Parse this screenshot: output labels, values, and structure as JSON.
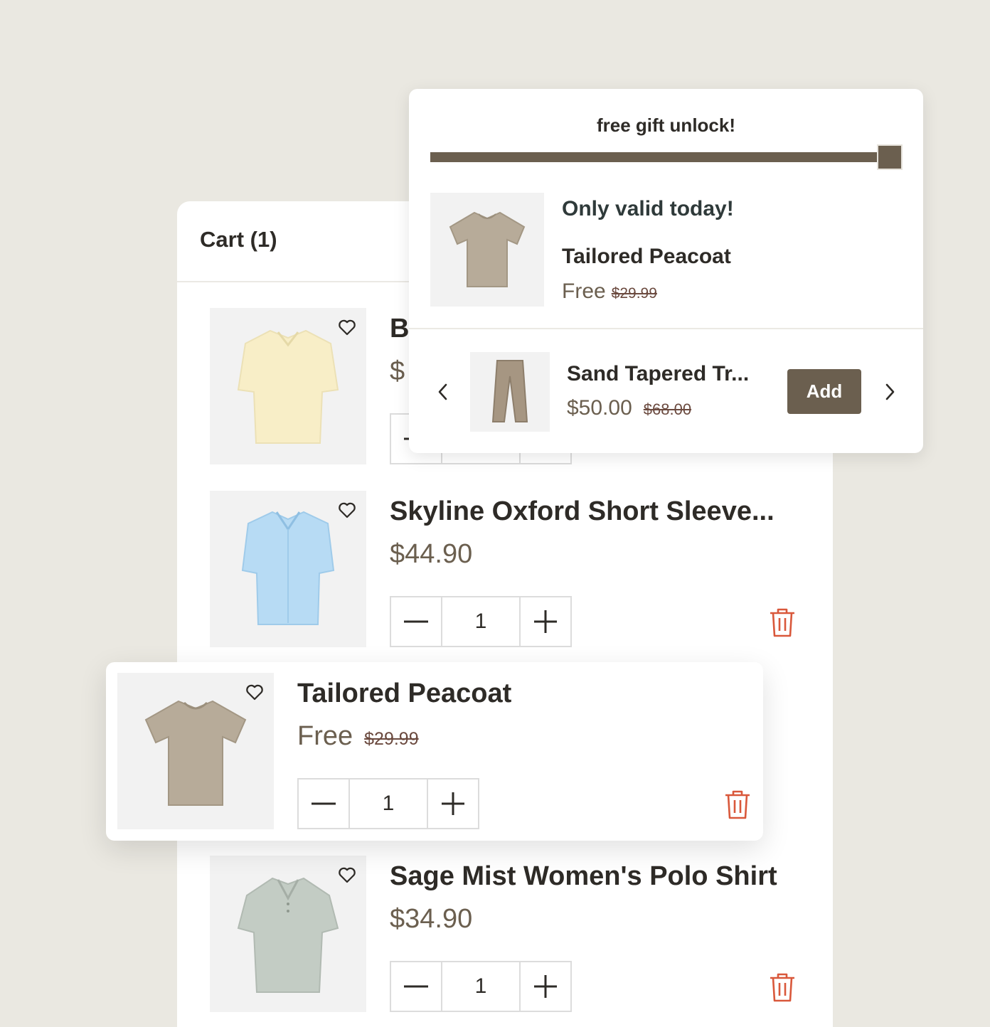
{
  "cart": {
    "title": "Cart (1)",
    "items": [
      {
        "name": "B",
        "price": "$",
        "qty": "1",
        "color": "#f8eec7"
      },
      {
        "name": "Skyline Oxford Short Sleeve...",
        "price": "$44.90",
        "qty": "1",
        "color": "#b7dbf4"
      },
      {
        "name": "Sage Mist Women's Polo Shirt",
        "price": "$34.90",
        "qty": "1",
        "color": "#c3ccc4"
      }
    ]
  },
  "gift_popup": {
    "title": "free gift unlock!",
    "progress_fraction": 1.0,
    "note": "Only valid today!",
    "product_name": "Tailored Peacoat",
    "price": "Free",
    "original_price": "$29.99",
    "upsell": {
      "name": "Sand Tapered Tr...",
      "price": "$50.00",
      "original_price": "$68.00",
      "add_label": "Add"
    }
  },
  "added_gift_item": {
    "name": "Tailored Peacoat",
    "price": "Free",
    "original_price": "$29.99",
    "qty": "1",
    "color": "#b7ab99"
  },
  "colors": {
    "accent": "#6b5f4f",
    "delete": "#d9583b",
    "background": "#eae8e1"
  },
  "icons": [
    "heart-icon",
    "minus-icon",
    "plus-icon",
    "trash-icon",
    "chevron-left-icon",
    "chevron-right-icon"
  ]
}
